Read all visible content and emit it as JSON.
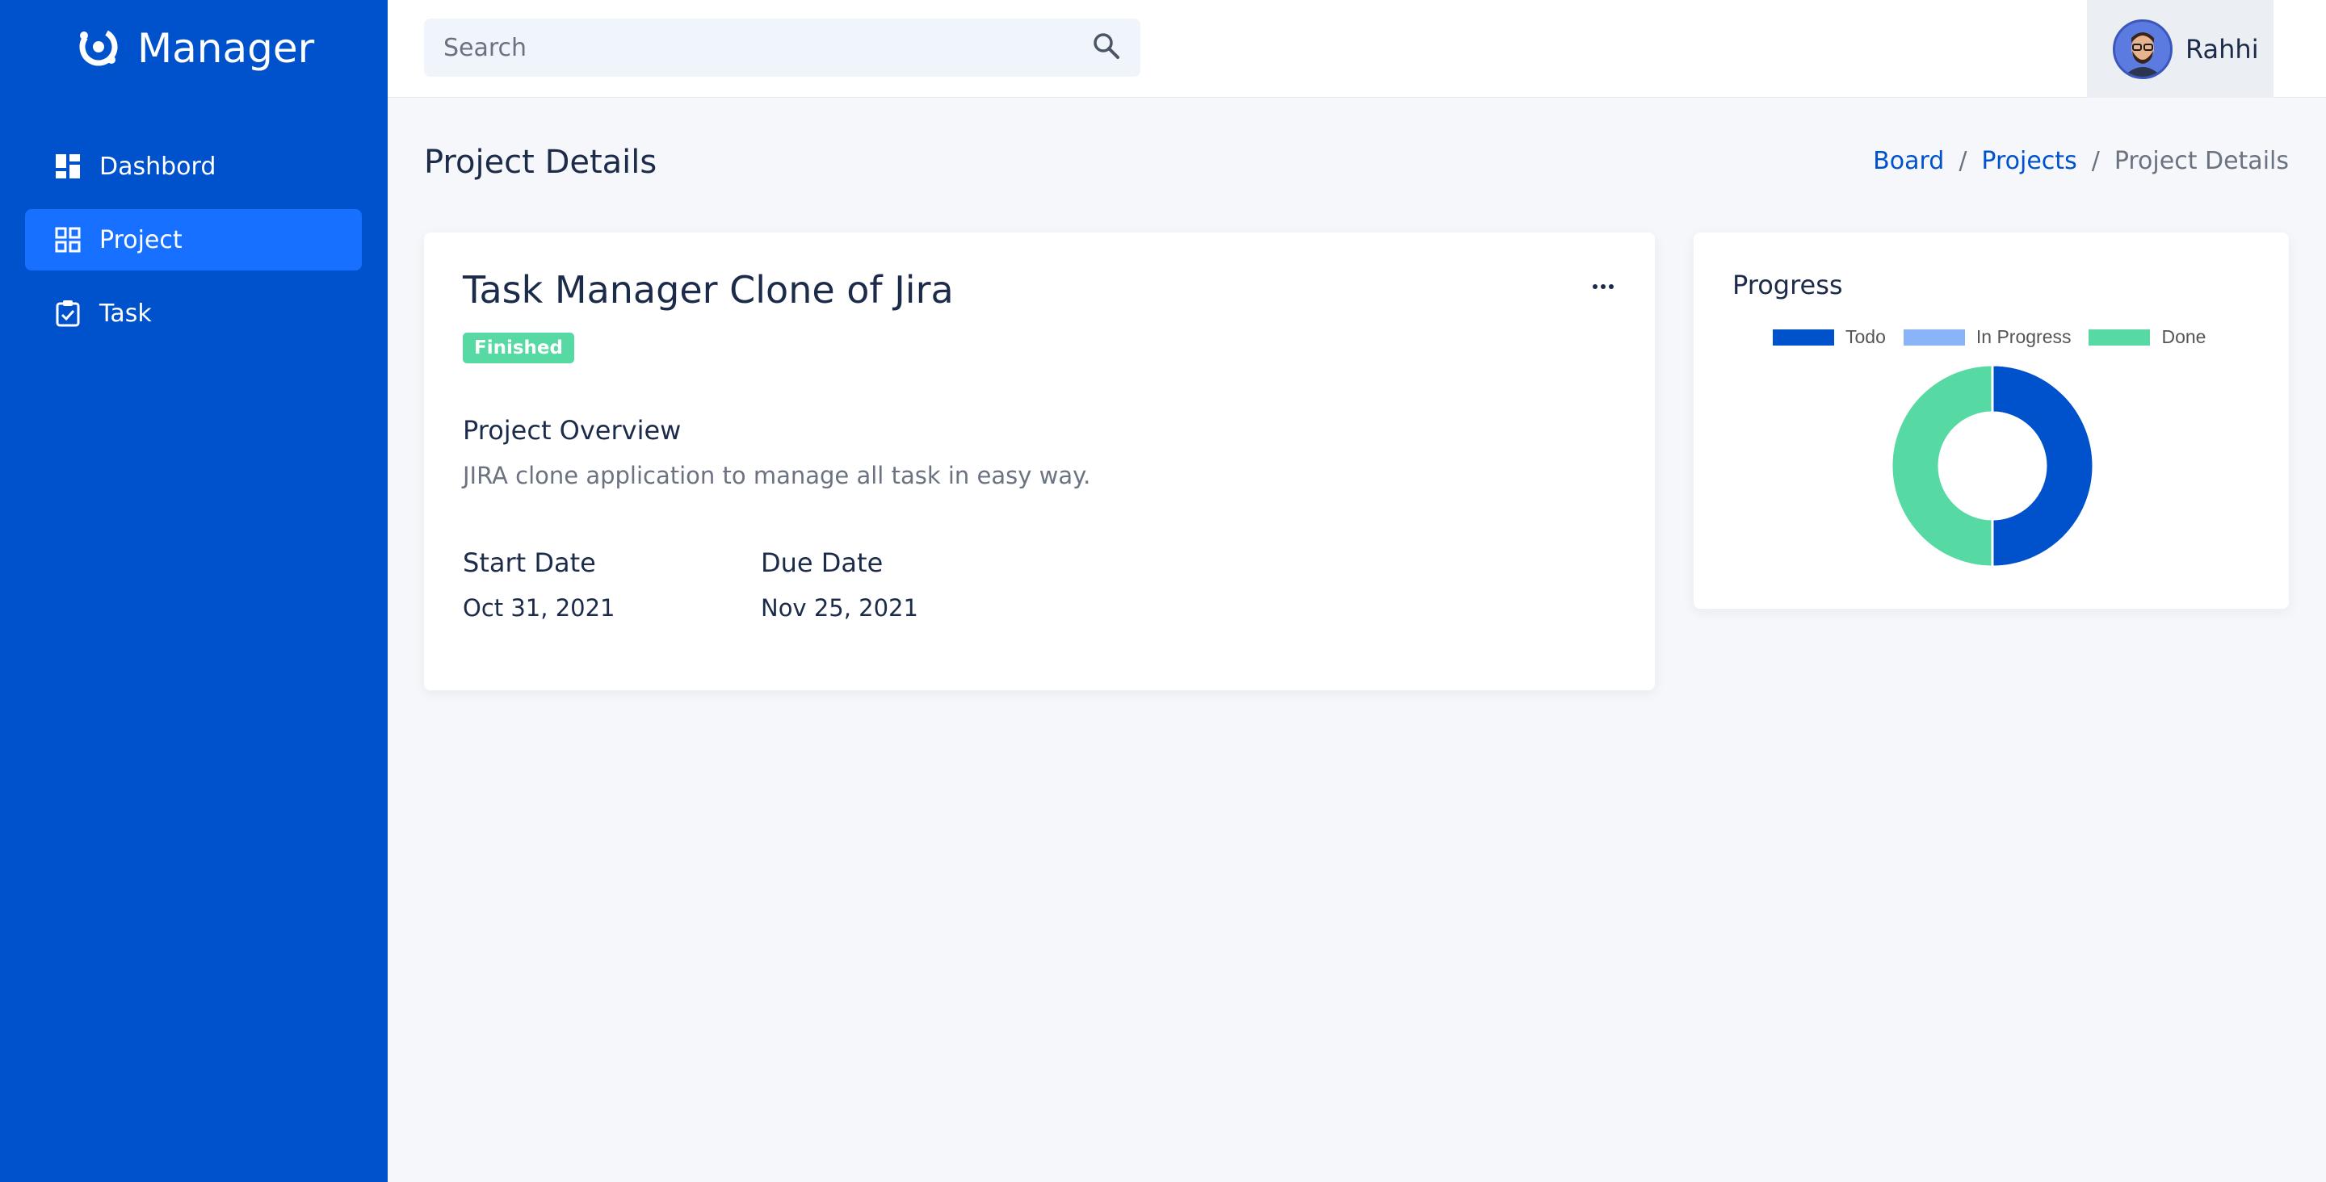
{
  "brand": {
    "name": "Manager"
  },
  "sidebar": {
    "items": [
      {
        "label": "Dashbord",
        "icon": "dashboard-icon",
        "active": false
      },
      {
        "label": "Project",
        "icon": "grid-icon",
        "active": true
      },
      {
        "label": "Task",
        "icon": "clipboard-check-icon",
        "active": false
      }
    ]
  },
  "header": {
    "search_placeholder": "Search",
    "user_name": "Rahhi"
  },
  "page": {
    "title": "Project Details",
    "breadcrumb": [
      "Board",
      "Projects",
      "Project Details"
    ],
    "breadcrumb_separator": "/"
  },
  "project": {
    "title": "Task Manager Clone of Jira",
    "status": "Finished",
    "overview_heading": "Project Overview",
    "overview_text": "JIRA clone application to manage all task in easy way.",
    "start_date_label": "Start Date",
    "start_date": "Oct 31, 2021",
    "due_date_label": "Due Date",
    "due_date": "Nov 25, 2021"
  },
  "progress": {
    "title": "Progress"
  },
  "chart_data": {
    "type": "pie",
    "variant": "doughnut",
    "labels": [
      "Todo",
      "In Progress",
      "Done"
    ],
    "values": [
      1,
      0,
      1
    ],
    "colors": [
      "#0052cc",
      "#8ab4f8",
      "#57d9a3"
    ],
    "legend_position": "top"
  },
  "colors": {
    "sidebar": "#0052cc",
    "active_nav": "#1770ff",
    "badge": "#57d9a3",
    "link": "#0052cc"
  }
}
